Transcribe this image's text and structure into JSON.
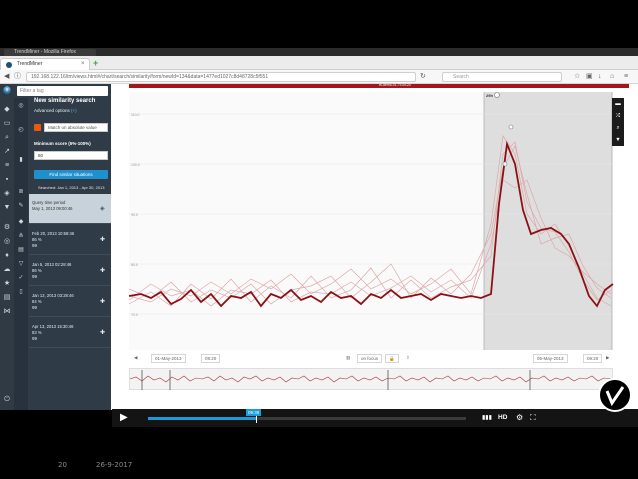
{
  "browser": {
    "top_tab_title": "TrendMiner - Mozilla Firefox",
    "tab_title": "TrendMiner",
    "url": "192.168.122.16/tm/views.html#/chart/search/similarity/form/newId=134&data=1477ed1027c8d48728c5f551",
    "search_placeholder": "Search",
    "new_tab": "+",
    "close_tab": "×"
  },
  "colors": {
    "accent_blue": "#1f8fce",
    "brand_red": "#a3161b",
    "series_highlight": "#8b1115",
    "series_muted": "#d9a8a8"
  },
  "sidebar": {
    "filter_placeholder": "Filter a tag",
    "title": "New similarity search",
    "advanced_label": "Advanced options",
    "advanced_link": "(+)",
    "match_mode": "Match on absolute value",
    "min_score_label": "Minimum score (5%-100%)",
    "min_score_value": "80",
    "find_button": "Find similar situations",
    "searched_range": "Searched: Jan 1, 2013 - Apr 30, 2013"
  },
  "results": [
    {
      "line1": "Query time period",
      "line2": "May 1, 2013 09:00:46",
      "score": ""
    },
    {
      "line1": "Feb 20, 2013 10:58:46",
      "line2": "86 %",
      "score": "99"
    },
    {
      "line1": "Jan 5, 2013 02:28:46",
      "line2": "86 %",
      "score": "99"
    },
    {
      "line1": "Jan 12, 2013 03:28:46",
      "line2": "84 %",
      "score": "99"
    },
    {
      "line1": "Apr 13, 2013 15:30:46",
      "line2": "83 %",
      "score": "99"
    }
  ],
  "main": {
    "tag_bar": "fs-demo-01-TI10124",
    "date_start": "01-May-2013",
    "time_start": "09:20",
    "date_end": "05-May-2013",
    "time_end": "09:20",
    "mode": "on focus",
    "selection_label": "29h"
  },
  "video": {
    "current_time": "09:38",
    "hd_label": "HD",
    "pct": 0.34
  },
  "footer": {
    "slide_number": "20",
    "date": "26-9-2017"
  }
}
